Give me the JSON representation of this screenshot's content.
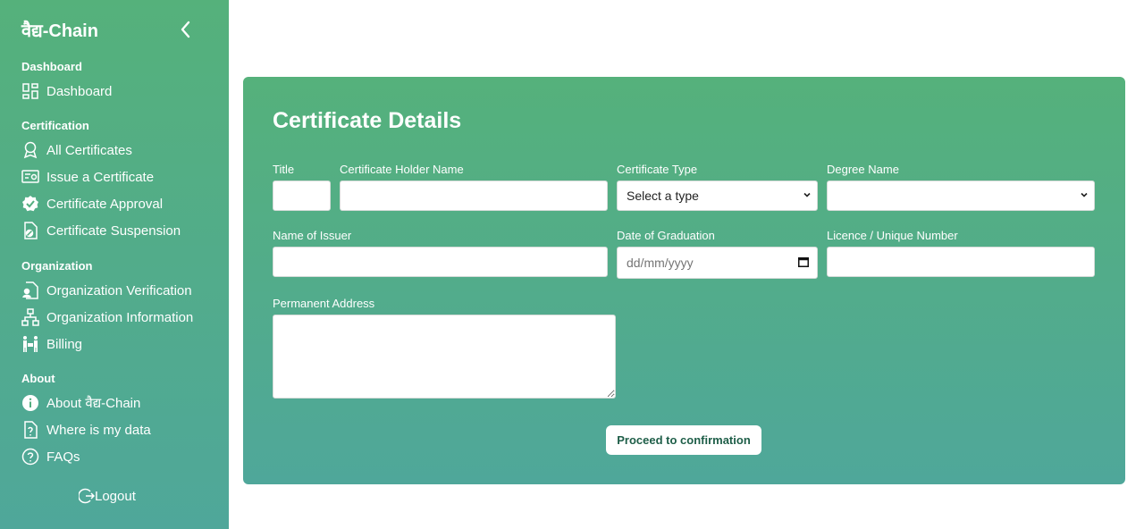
{
  "sidebar": {
    "brand": "वैद्य-Chain",
    "sections": {
      "dashboard": "Dashboard",
      "certification": "Certification",
      "organization": "Organization",
      "about": "About"
    },
    "items": {
      "dashboard": "Dashboard",
      "all_certificates": "All Certificates",
      "issue_certificate": "Issue a Certificate",
      "certificate_approval": "Certificate Approval",
      "certificate_suspension": "Certificate Suspension",
      "organization_verification": "Organization Verification",
      "organization_information": "Organization Information",
      "billing": "Billing",
      "about_chain": "About वैद्य-Chain",
      "where_is_my_data": "Where is my data",
      "faqs": "FAQs"
    },
    "logout": "Logout"
  },
  "form": {
    "title": "Certificate Details",
    "labels": {
      "title": "Title",
      "holder_name": "Certificate Holder Name",
      "certificate_type": "Certificate Type",
      "degree_name": "Degree Name",
      "issuer_name": "Name of Issuer",
      "graduation_date": "Date of Graduation",
      "licence": "Licence / Unique Number",
      "address": "Permanent Address"
    },
    "values": {
      "title": "",
      "holder_name": "",
      "issuer_name": "",
      "licence": "",
      "address": ""
    },
    "certificate_type_selected": "Select a type",
    "degree_name_selected": "",
    "date_placeholder": "dd/mm/yyyy",
    "proceed_label": "Proceed to confirmation"
  },
  "colors": {
    "gradient_top": "#55b17b",
    "gradient_bottom": "#4fa79a",
    "button_text": "#1e5e48"
  }
}
